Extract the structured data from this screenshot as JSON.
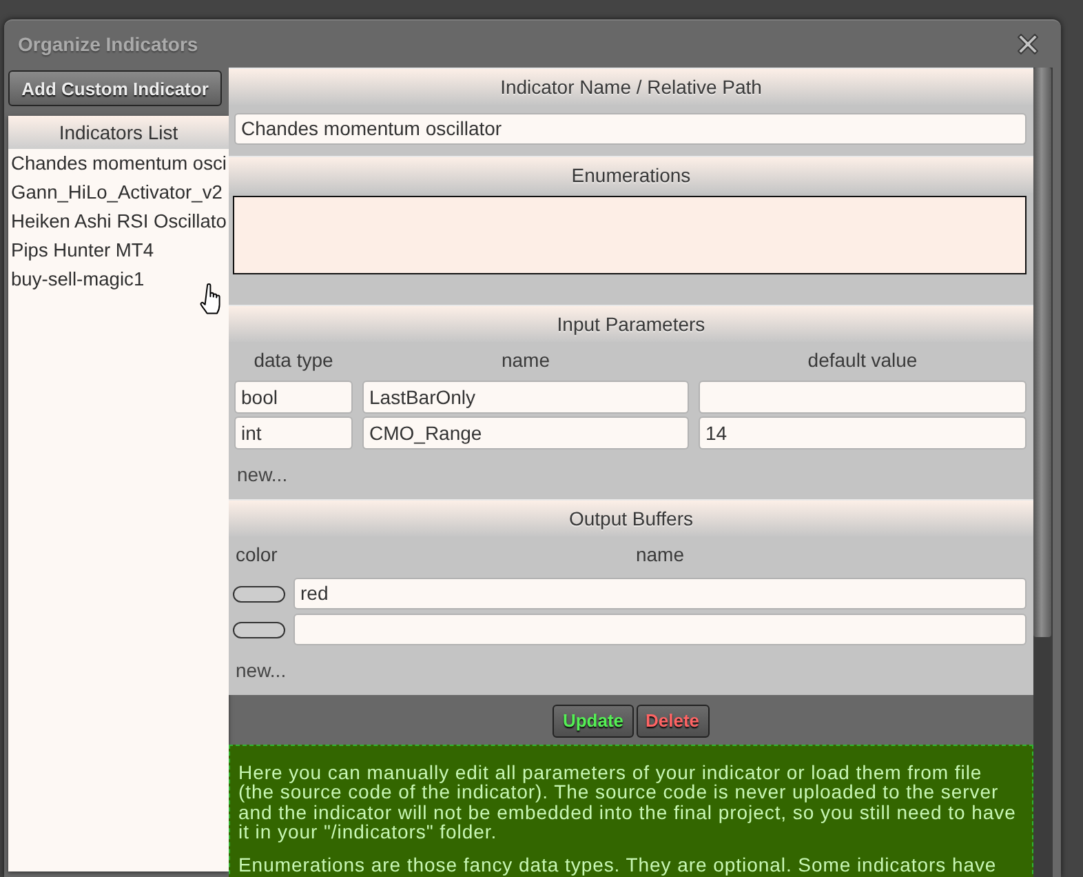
{
  "window": {
    "title": "Organize Indicators"
  },
  "sidebar": {
    "add_button": "Add Custom Indicator",
    "list_title": "Indicators List",
    "items": [
      {
        "label": "Chandes momentum osci",
        "selected": false
      },
      {
        "label": "Gann_HiLo_Activator_v2",
        "selected": false
      },
      {
        "label": "Heiken Ashi RSI Oscillato",
        "selected": false
      },
      {
        "label": "Pips Hunter MT4",
        "selected": false
      },
      {
        "label": "buy-sell-magic1",
        "selected": false
      }
    ]
  },
  "indicator_name": {
    "title": "Indicator Name / Relative Path",
    "value": "Chandes momentum oscillator"
  },
  "enumerations": {
    "title": "Enumerations"
  },
  "input_parameters": {
    "title": "Input Parameters",
    "columns": [
      "data type",
      "name",
      "default value"
    ],
    "rows": [
      {
        "data_type": "bool",
        "name": "LastBarOnly"
      },
      {
        "data_type": "int",
        "name": "CMO_Range",
        "default_value": "14"
      }
    ],
    "new_link": "new..."
  },
  "output_buffers": {
    "title": "Output Buffers",
    "columns": [
      "color",
      "name"
    ],
    "rows": [
      {
        "name": "red"
      },
      {}
    ],
    "new_link": "new..."
  },
  "actions": [
    {
      "kind": "update",
      "label": "Update"
    },
    {
      "kind": "delete",
      "label": "Delete"
    }
  ],
  "help": {
    "paragraphs": [
      "Here you can manually edit all parameters of your indicator or load them from file (the source code of the indicator). The source code is never uploaded to the server and the indicator will not be embedded into the final project, so you still need to have it in your \"/indicators\" folder.",
      "Enumerations are those fancy data types. They are optional. Some indicators have"
    ]
  }
}
